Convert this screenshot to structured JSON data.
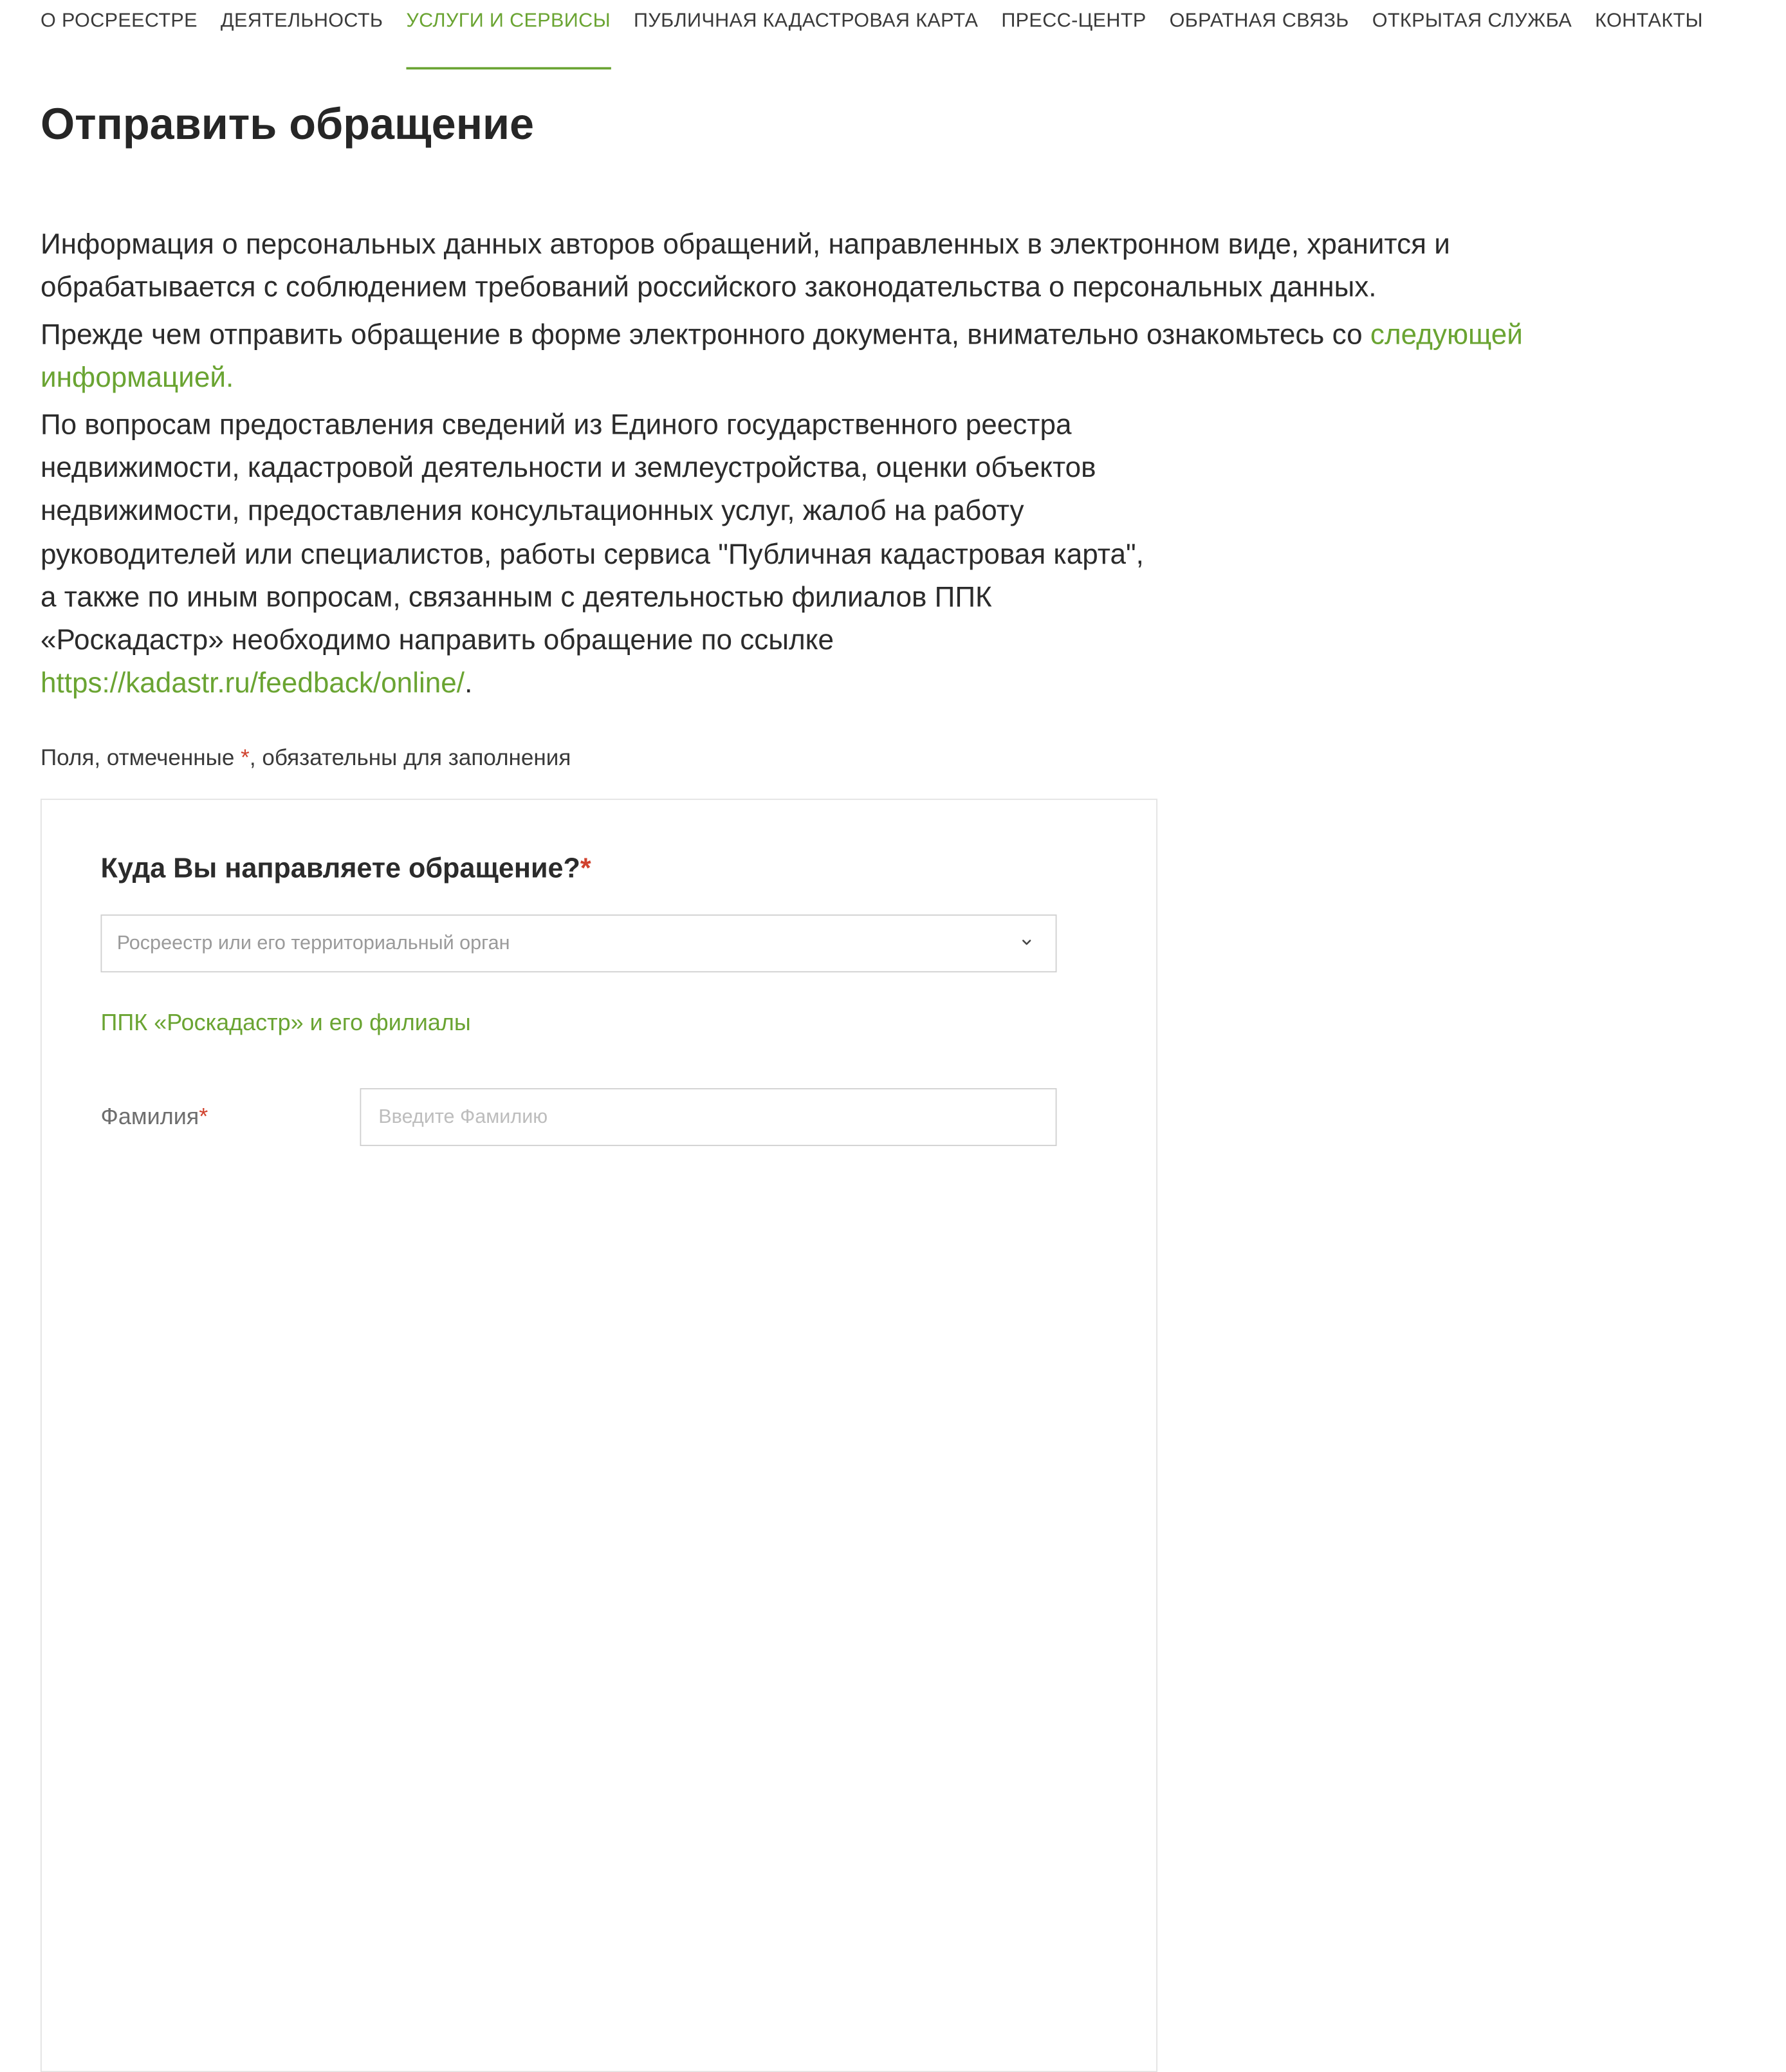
{
  "nav": {
    "items": [
      {
        "label": "О РОСРЕЕСТРЕ",
        "active": false
      },
      {
        "label": "ДЕЯТЕЛЬНОСТЬ",
        "active": false
      },
      {
        "label": "УСЛУГИ И СЕРВИСЫ",
        "active": true
      },
      {
        "label": "ПУБЛИЧНАЯ КАДАСТРОВАЯ КАРТА",
        "active": false
      },
      {
        "label": "ПРЕСС-ЦЕНТР",
        "active": false
      },
      {
        "label": "ОБРАТНАЯ СВЯЗЬ",
        "active": false
      },
      {
        "label": "ОТКРЫТАЯ СЛУЖБА",
        "active": false
      },
      {
        "label": "КОНТАКТЫ",
        "active": false
      }
    ]
  },
  "page": {
    "title": "Отправить обращение"
  },
  "intro": {
    "p1": "Информация о персональных данных авторов обращений, направленных в электронном виде, хранится и обрабатывается с соблюдением требований российского законодательства о персональных данных.",
    "p2_text": "Прежде чем отправить обращение в форме электронного документа, внимательно ознакомьтесь со ",
    "p2_link": "следующей информацией.",
    "p3_text": "По вопросам предоставления сведений из Единого государственного реестра недвижимости, кадастровой деятельности и землеустройства, оценки объектов недвижимости, предоставления консультационных услуг, жалоб на работу руководителей или специалистов, работы сервиса \"Публичная кадастровая карта\", а также по иным вопросам, связанным с деятельностью филиалов ППК «Роскадастр» необходимо направить обращение по ссылке ",
    "p3_link": "https://kadastr.ru/feedback/online/",
    "p3_end": "."
  },
  "required_note": {
    "before": "Поля, отмеченные ",
    "star": "*",
    "after": ", обязательны для заполнения"
  },
  "form": {
    "question": "Куда Вы направляете обращение?",
    "question_star": "*",
    "select_value": "Росреестр или его территориальный орган",
    "option_link": "ППК «Роскадастр» и его филиалы",
    "surname_label": "Фамилия",
    "surname_star": "*",
    "surname_placeholder": "Введите Фамилию"
  },
  "colors": {
    "accent": "#6aa432",
    "required": "#d0422e",
    "text": "#2b2b2b"
  },
  "icons": {
    "select_chevron": "chevron-down-icon"
  }
}
